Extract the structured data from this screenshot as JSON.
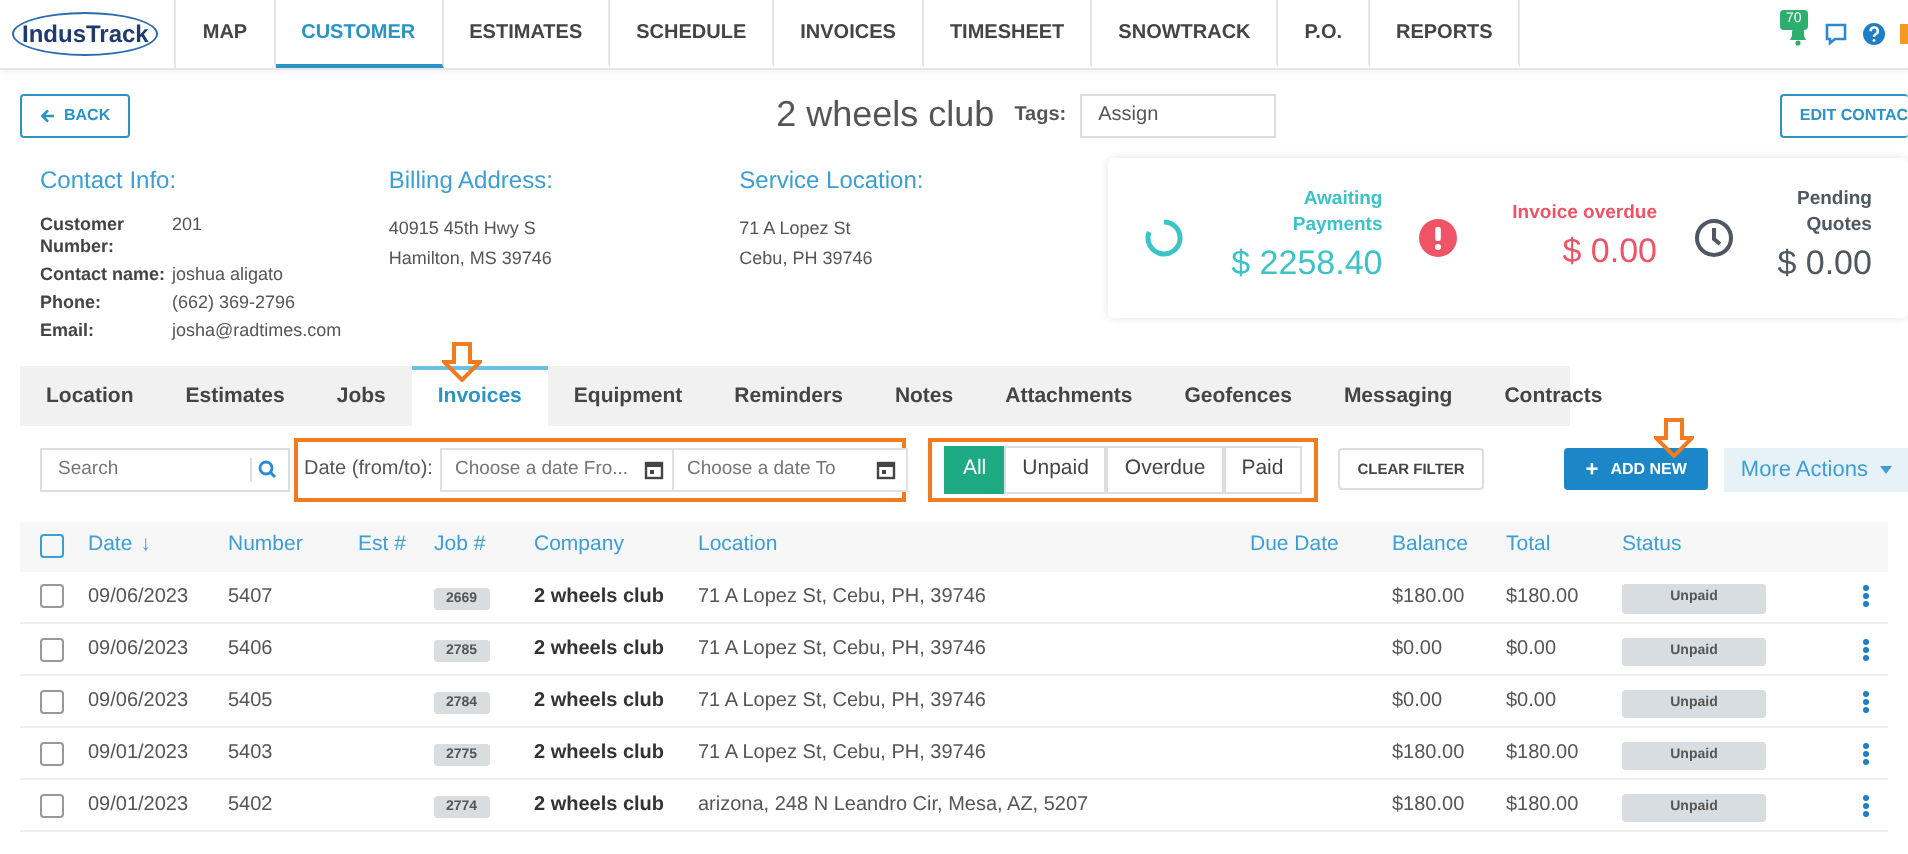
{
  "logo": {
    "text": "IndusTrack"
  },
  "nav": [
    {
      "label": "MAP",
      "selected": false
    },
    {
      "label": "CUSTOMER",
      "selected": true
    },
    {
      "label": "ESTIMATES",
      "selected": false
    },
    {
      "label": "SCHEDULE",
      "selected": false
    },
    {
      "label": "INVOICES",
      "selected": false
    },
    {
      "label": "TIMESHEET",
      "selected": false
    },
    {
      "label": "SNOWTRACK",
      "selected": false
    },
    {
      "label": "P.O.",
      "selected": false
    },
    {
      "label": "REPORTS",
      "selected": false
    }
  ],
  "notification_count": "70",
  "back_button": "BACK",
  "title": "2 wheels club",
  "tags": {
    "label": "Tags:",
    "value": "Assign"
  },
  "edit_button": "EDIT CONTAC",
  "contact_info": {
    "heading": "Contact Info:",
    "fields": [
      {
        "label": "Customer Number:",
        "value": "201"
      },
      {
        "label": "Contact name:",
        "value": "joshua aligato"
      },
      {
        "label": "Phone:",
        "value": "(662) 369-2796"
      },
      {
        "label": "Email:",
        "value": "josha@radtimes.com"
      }
    ]
  },
  "billing_address": {
    "heading": "Billing Address:",
    "lines": [
      "40915 45th Hwy S",
      "Hamilton, MS 39746"
    ]
  },
  "service_location": {
    "heading": "Service Location:",
    "lines": [
      "71 A Lopez St",
      "Cebu, PH 39746"
    ]
  },
  "stats": [
    {
      "kind": "awaiting",
      "label": "Awaiting Payments",
      "amount": "$ 2258.40",
      "color": "#3cc3c8"
    },
    {
      "kind": "overdue",
      "label": "Invoice overdue",
      "amount": "$ 0.00",
      "color": "#ef5466"
    },
    {
      "kind": "pending",
      "label": "Pending Quotes",
      "amount": "$ 0.00",
      "color": "#4f5761"
    }
  ],
  "tabs": [
    {
      "label": "Location",
      "selected": false
    },
    {
      "label": "Estimates",
      "selected": false
    },
    {
      "label": "Jobs",
      "selected": false
    },
    {
      "label": "Invoices",
      "selected": true
    },
    {
      "label": "Equipment",
      "selected": false
    },
    {
      "label": "Reminders",
      "selected": false
    },
    {
      "label": "Notes",
      "selected": false
    },
    {
      "label": "Attachments",
      "selected": false
    },
    {
      "label": "Geofences",
      "selected": false
    },
    {
      "label": "Messaging",
      "selected": false
    },
    {
      "label": "Contracts",
      "selected": false
    }
  ],
  "search": {
    "placeholder": "Search"
  },
  "date_filter": {
    "label": "Date (from/to):",
    "from_placeholder": "Choose a date Fro...",
    "to_placeholder": "Choose a date To"
  },
  "status_filters": [
    {
      "label": "All",
      "selected": true
    },
    {
      "label": "Unpaid",
      "selected": false
    },
    {
      "label": "Overdue",
      "selected": false
    },
    {
      "label": "Paid",
      "selected": false
    }
  ],
  "clear_filter": "CLEAR FILTER",
  "add_new": "ADD NEW",
  "add_new_icon": "+",
  "more_actions": "More Actions",
  "table": {
    "all_checked": false,
    "columns": [
      "Date",
      "Number",
      "Est #",
      "Job #",
      "Company",
      "Location",
      "Due Date",
      "Balance",
      "Total",
      "Status"
    ],
    "sort_indicator": "↓",
    "rows": [
      {
        "checked": false,
        "date": "09/06/2023",
        "number": "5407",
        "job": "2669",
        "company": "2 wheels club",
        "location": "71 A Lopez St, Cebu, PH, 39746",
        "balance": "$180.00",
        "total": "$180.00",
        "status": "Unpaid"
      },
      {
        "checked": false,
        "date": "09/06/2023",
        "number": "5406",
        "job": "2785",
        "company": "2 wheels club",
        "location": "71 A Lopez St, Cebu, PH, 39746",
        "balance": "$0.00",
        "total": "$0.00",
        "status": "Unpaid"
      },
      {
        "checked": false,
        "date": "09/06/2023",
        "number": "5405",
        "job": "2784",
        "company": "2 wheels club",
        "location": "71 A Lopez St, Cebu, PH, 39746",
        "balance": "$0.00",
        "total": "$0.00",
        "status": "Unpaid"
      },
      {
        "checked": false,
        "date": "09/01/2023",
        "number": "5403",
        "job": "2775",
        "company": "2 wheels club",
        "location": "71 A Lopez St, Cebu, PH, 39746",
        "balance": "$180.00",
        "total": "$180.00",
        "status": "Unpaid"
      },
      {
        "checked": false,
        "date": "09/01/2023",
        "number": "5402",
        "job": "2774",
        "company": "2 wheels club",
        "location": "arizona, 248 N Leandro Cir, Mesa, AZ, 5207",
        "balance": "$180.00",
        "total": "$180.00",
        "status": "Unpaid"
      }
    ]
  }
}
